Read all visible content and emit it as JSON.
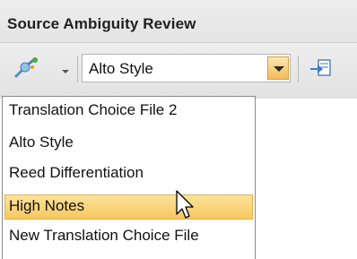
{
  "panel": {
    "title": "Source Ambiguity Review"
  },
  "toolbar": {
    "primary_icon": "connect-icon",
    "secondary_icon": "import-icon",
    "combo": {
      "selected_value": "Alto Style"
    }
  },
  "dropdown": {
    "items": [
      {
        "label": "Translation Choice File 2",
        "selected": false
      },
      {
        "label": "Alto Style",
        "selected": false
      },
      {
        "label": "Reed Differentiation",
        "selected": false
      },
      {
        "label": "High Notes",
        "selected": true
      },
      {
        "label": "New Translation Choice File",
        "selected": false
      }
    ]
  },
  "colors": {
    "highlight": "#f6c860",
    "dropdown_button": "#f5bb58"
  }
}
